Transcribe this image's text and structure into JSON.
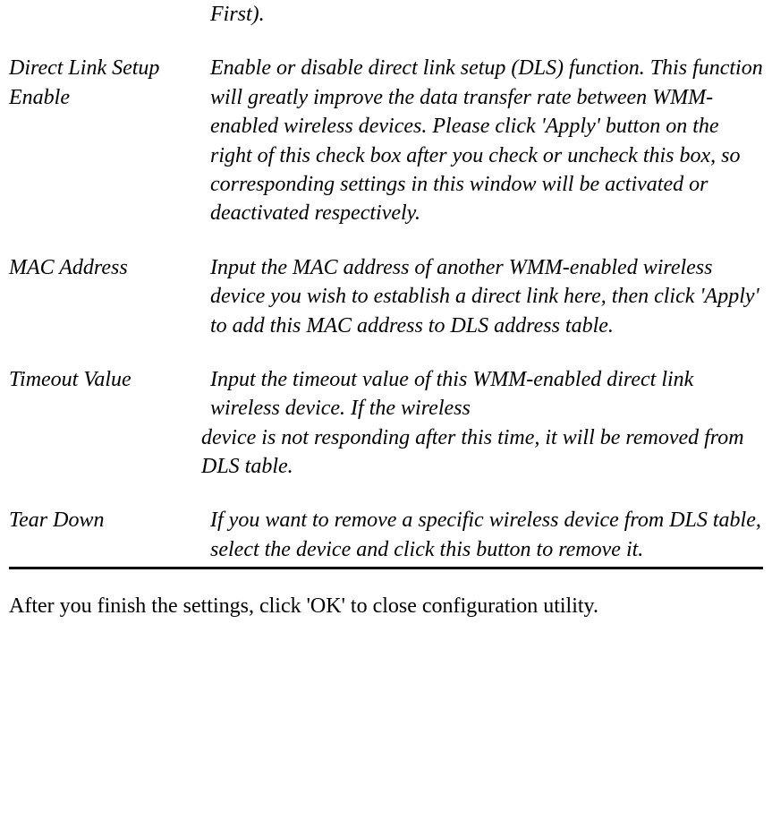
{
  "rows": [
    {
      "label": "",
      "description": "First)."
    },
    {
      "label": "Direct Link Setup Enable",
      "description": "Enable or disable direct link setup (DLS) function. This function will greatly improve the data transfer rate between WMM-enabled wireless devices. Please click 'Apply' button on the right of this check box after you check or uncheck this box, so corresponding settings in this window will be activated or deactivated respectively."
    },
    {
      "label": "MAC Address",
      "description": "Input the MAC address of another WMM-enabled wireless device you wish to establish a direct link here, then click 'Apply' to add this MAC address to DLS address table."
    },
    {
      "label": "Timeout Value",
      "description": "Input the timeout value of this WMM-enabled direct link wireless device. If the wireless",
      "description2": "device is not responding after this time, it will be removed from DLS table."
    },
    {
      "label": "Tear Down",
      "description": "If you want to remove a specific wireless device from DLS table, select the device and click this button to remove it."
    }
  ],
  "footer": "After you finish the settings, click 'OK' to close configuration utility."
}
